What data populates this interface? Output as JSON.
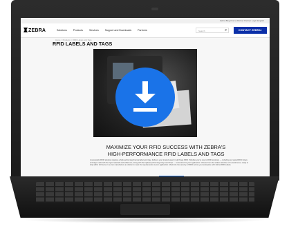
{
  "topbar": {
    "links": "Zebra Blog   Find a Partner   Partner Login   English"
  },
  "header": {
    "logo_text": "ZEBRA",
    "nav": [
      "Solutions",
      "Products",
      "Services",
      "Support and Downloads",
      "Partners"
    ],
    "search_placeholder": "Search",
    "contact_label": "CONTACT ZEBRA  ›"
  },
  "main": {
    "breadcrumb": "Home > Products > RFID Labels and Tags",
    "title": "RFID LABELS AND TAGS",
    "promo_heading": "MAXIMIZE YOUR RFID SUCCESS WITH ZEBRA'S HIGH-PERFORMANCE RFID LABELS AND TAGS",
    "promo_body": "A successful RFID solution requires a high-performing thermal label and inlay. Zebra is your trusted expert in all things RFID. Whether you're new to RFID solutions — including our tested RFID inlays and tags made with the right materials and adhesives, along with the highest-performing inlays and chips — customized to your application. Choose from the widest selection of in-stock items, ready to ship within 24 hours or we can manufacture a solution to meet the requirements of your application. Maximize the security of RFID across your enterprise with Zebra RFID Labels.",
    "cta_label": ""
  },
  "overlay": {
    "icon": "download-icon"
  },
  "colors": {
    "accent": "#1a73e8",
    "contact": "#0b2fa8"
  }
}
